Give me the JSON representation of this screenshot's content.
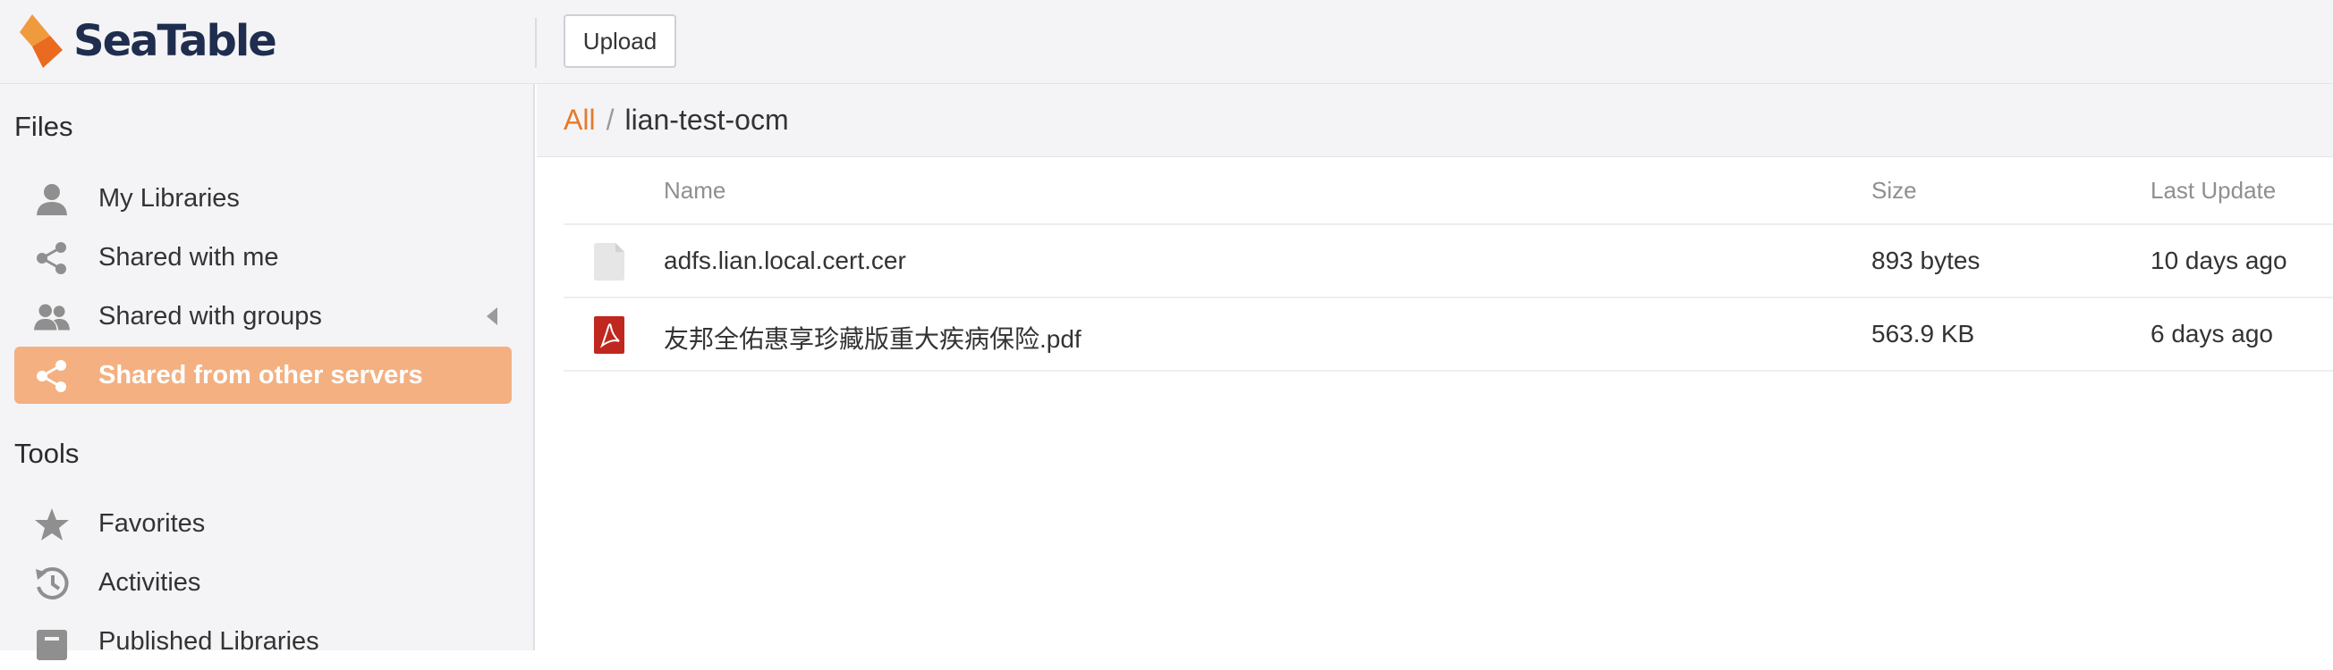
{
  "app": {
    "name": "SeaTable",
    "brand_color": "#e57b2b",
    "upload_label": "Upload"
  },
  "sidebar": {
    "files_heading": "Files",
    "items": [
      {
        "label": "My Libraries",
        "icon": "user-icon"
      },
      {
        "label": "Shared with me",
        "icon": "share-icon"
      },
      {
        "label": "Shared with groups",
        "icon": "group-icon"
      },
      {
        "label": "Shared from other servers",
        "icon": "share-icon",
        "active": true
      }
    ],
    "tools_heading": "Tools",
    "tools": [
      {
        "label": "Favorites",
        "icon": "star-icon"
      },
      {
        "label": "Activities",
        "icon": "history-icon"
      },
      {
        "label": "Published Libraries",
        "icon": "book-icon"
      }
    ]
  },
  "breadcrumb": {
    "root": "All",
    "separator": "/",
    "current": "lian-test-ocm"
  },
  "table": {
    "headers": {
      "name": "Name",
      "size": "Size",
      "last_update": "Last Update"
    },
    "rows": [
      {
        "icon": "file-icon",
        "name": "adfs.lian.local.cert.cer",
        "size": "893 bytes",
        "updated": "10 days ago"
      },
      {
        "icon": "pdf-icon",
        "name": "友邦全佑惠享珍藏版重大疾病保险.pdf",
        "size": "563.9 KB",
        "updated": "6 days ago"
      }
    ]
  }
}
